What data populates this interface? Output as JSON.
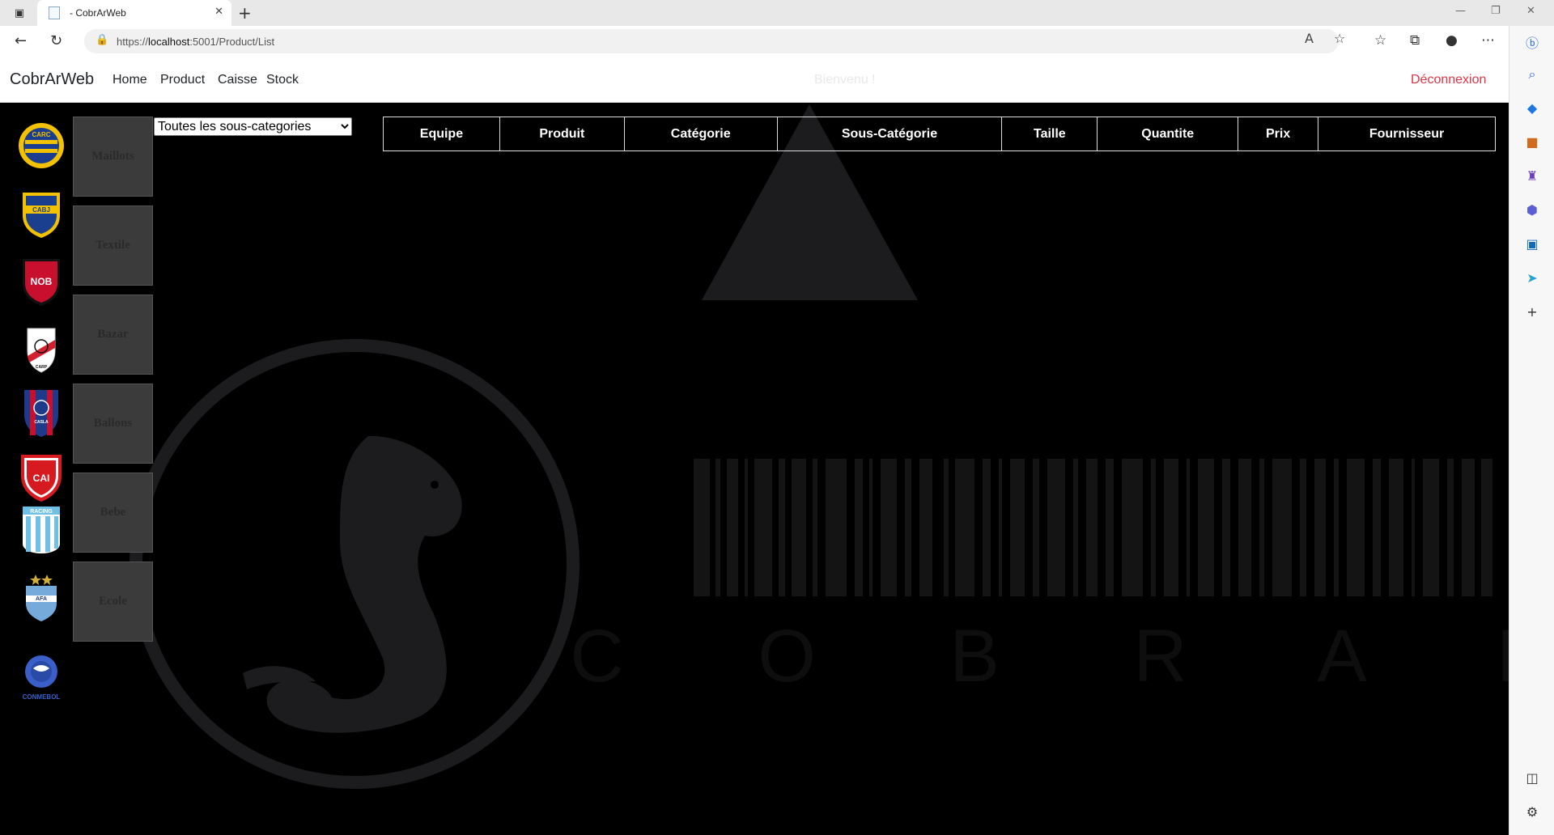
{
  "browser": {
    "tab_title": "- CobrArWeb",
    "url_prefix": "https://",
    "url_host": "localhost",
    "url_rest": ":5001/Product/List"
  },
  "site": {
    "brand": "CobrArWeb",
    "nav": [
      "Home",
      "Product",
      "Caisse",
      "Stock"
    ],
    "welcome": "Bienvenu !",
    "logout": "Déconnexion"
  },
  "categories": [
    "Maillots",
    "Textile",
    "Bazar",
    "Ballons",
    "Bebe",
    "Ecole"
  ],
  "teams": [
    {
      "name": "Rosario Central",
      "abbr": "CARC",
      "primary": "#1a3d8f",
      "secondary": "#f2c200"
    },
    {
      "name": "Boca Juniors",
      "abbr": "CABJ",
      "primary": "#1b3f8f",
      "secondary": "#f2c200"
    },
    {
      "name": "Newell's Old Boys",
      "abbr": "NOB",
      "primary": "#c8102e",
      "secondary": "#111111"
    },
    {
      "name": "River Plate",
      "abbr": "CARP",
      "primary": "#ffffff",
      "secondary": "#d2202f"
    },
    {
      "name": "San Lorenzo",
      "abbr": "CASLA",
      "primary": "#1e3a8a",
      "secondary": "#c8102e"
    },
    {
      "name": "Independiente",
      "abbr": "CAI",
      "primary": "#d71920",
      "secondary": "#ffffff"
    },
    {
      "name": "Racing Club",
      "abbr": "RACING",
      "primary": "#6ec1e4",
      "secondary": "#ffffff"
    },
    {
      "name": "Argentina AFA",
      "abbr": "AFA",
      "primary": "#75aadb",
      "secondary": "#d4af37"
    },
    {
      "name": "Conmebol",
      "abbr": "CONMEBOL",
      "primary": "#3a5fc8",
      "secondary": "#ffffff"
    }
  ],
  "filter": {
    "selected": "Toutes les sous-categories"
  },
  "table": {
    "headers": [
      "Equipe",
      "Produit",
      "Catégorie",
      "Sous-Catégorie",
      "Taille",
      "Quantite",
      "Prix",
      "Fournisseur"
    ]
  },
  "watermark": {
    "text": "C O B R A R"
  },
  "colors": {
    "logout": "#dc3545",
    "page_bg": "#000000",
    "tile_bg": "#3b3b3b"
  }
}
